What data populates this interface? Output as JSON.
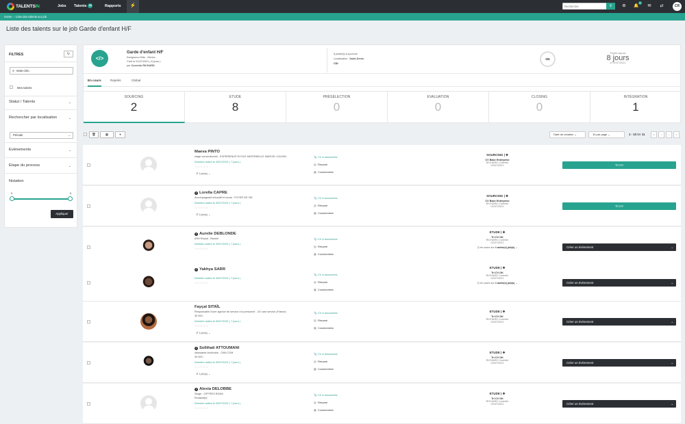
{
  "nav": {
    "logo_main": "TALENTS",
    "logo_accent": "IN",
    "items": [
      {
        "label": "Jobs",
        "badge": ""
      },
      {
        "label": "Talents",
        "badge": "99"
      },
      {
        "label": "Rapports",
        "badge": ""
      }
    ],
    "search_placeholder": "Recherche",
    "notifications_badge": "12",
    "user_initials": "CR"
  },
  "breadcrumb": [
    "Home",
    "Liste des talents sur job"
  ],
  "page_title": "Liste des talents sur le job Garde d'enfant H/F",
  "filters": {
    "title": "FILTRES",
    "keyword_placeholder": "Mots-clés :",
    "my_talents_label": "Mes talents",
    "sections": [
      "Statut / Talents",
      "Rechercher par localisation",
      "Evénements",
      "Etape du process",
      "Notation"
    ],
    "period_placeholder": "Période",
    "rating_min": "0",
    "rating_max": "5",
    "apply_label": "Appliquer"
  },
  "job": {
    "title": "Garde d'enfant H/F",
    "company": "Kangourou Kids - Nîmes -",
    "created": "Créé le 01/07/2021 ( 8 jours )",
    "by_prefix": "par",
    "by_name": "Corentin RICHARD",
    "positions_count": "1",
    "positions_label": "poste(s) à pourvoir",
    "location_label": "Localisation :",
    "location": "Saint-Denis",
    "contract": "CDI",
    "progress": "0/5",
    "published_label": "Publié depuis",
    "published_value": "8 jours",
    "published_date": "le 01/07/2021",
    "tabs": [
      "En cours",
      "Rejetés",
      "Global"
    ]
  },
  "stages": [
    {
      "name": "SOURCING",
      "count": "2"
    },
    {
      "name": "ETUDE",
      "count": "8"
    },
    {
      "name": "PRÉSÉLECTION",
      "count": "0"
    },
    {
      "name": "EVALUATION",
      "count": "0"
    },
    {
      "name": "CLOSING",
      "count": "0"
    },
    {
      "name": "INTÉGRATION",
      "count": "1"
    }
  ],
  "toolbar": {
    "sort": "Date de création",
    "per_page": "10 par page",
    "range": "1 - 10",
    "of": "De",
    "total": "11"
  },
  "rows": [
    {
      "name": "Maeva PINTO",
      "info": false,
      "desc1": "stage conventionnel - EXPERIENCE ECOLE MATERNELLE MARCEL CACHIN",
      "desc2": "",
      "last": "Dernière action le 02/07/2021 ( 7 jours )",
      "jobs": "1 job(s)",
      "cv": "CV & documents",
      "resume": "Résumé",
      "contact": "Coordonnées",
      "stage": "SOURCING",
      "step": "CV Base Enterprise",
      "by": "RICHARD Corentin",
      "date": "02/07/2021",
      "other": "",
      "btn": "Tri CV",
      "btn_type": "teal"
    },
    {
      "name": "Lorella CAPRE",
      "info": true,
      "desc1": "Accompagnant éducatif et social - FOYER DE VIE",
      "desc2": "",
      "last": "Dernière action le 02/07/2021 ( 7 jours )",
      "jobs": "1 job(s)",
      "cv": "CV & documents",
      "resume": "Résumé",
      "contact": "Coordonnées",
      "stage": "SOURCING",
      "step": "CV Base Enterprise",
      "by": "RICHARD Corentin",
      "date": "02/07/2021",
      "other": "",
      "btn": "Tri CV",
      "btn_type": "teal"
    },
    {
      "name": "Aurelie DEBLONDE",
      "info": true,
      "desc1": "ASH Ehpad - Bandol",
      "desc2": "",
      "last": "Dernière action le 02/07/2021 ( 7 jours )",
      "jobs": "",
      "cv": "CV & documents",
      "resume": "Résumé",
      "contact": "Coordonnées",
      "stage": "ETUDE",
      "step": "Tri CV OK",
      "by": "RICHARD Corentin",
      "date": "02/07/2021",
      "other": "1 autre(s) job(s)",
      "btn": "Créer un événement",
      "btn_type": "dark"
    },
    {
      "name": "Yakhya SARR",
      "info": true,
      "desc1": "",
      "desc2": "",
      "last": "Dernière action le 02/07/2021 ( 7 jours )",
      "jobs": "",
      "cv": "CV & documents",
      "resume": "Résumé",
      "contact": "Coordonnées",
      "stage": "ETUDE",
      "step": "Tri CV OK",
      "by": "RICHARD Corentin",
      "date": "02/07/2021",
      "other": "1 autre(s) job(s)",
      "btn": "Créer un événement",
      "btn_type": "dark"
    },
    {
      "name": "Fayçal SITAÏL",
      "info": false,
      "desc1": "Responsable d'une agence de service à la personne - O2 care service (France)",
      "desc2": "30 000 -",
      "last": "Dernière action le 02/07/2021 ( 7 jours )",
      "jobs": "1 job(s)",
      "cv": "CV & documents",
      "resume": "Résumé",
      "contact": "Coordonnées",
      "stage": "ETUDE",
      "step": "Tri CV OK",
      "by": "RICHARD Corentin",
      "date": "02/07/2021",
      "other": "",
      "btn": "Créer un événement",
      "btn_type": "dark"
    },
    {
      "name": "Sollihati ATTOUMANI",
      "info": true,
      "desc1": "Assistante Archiviste - CMA CGM",
      "desc2": "30 000 -",
      "last": "Dernière action le 02/07/2021 ( 7 jours )",
      "jobs": "1 job(s)",
      "cv": "CV & documents",
      "resume": "Résumé",
      "contact": "Coordonnées",
      "stage": "ETUDE",
      "step": "Tri CV OK",
      "by": "RICHARD Corentin",
      "date": "02/07/2021",
      "other": "",
      "btn": "Créer un événement",
      "btn_type": "dark"
    },
    {
      "name": "Alexia DELOBBE",
      "info": true,
      "desc1": "Stage - CIFFREO BONA",
      "desc2": "Etudiant(e)",
      "last": "Dernière action le 02/07/2021 ( 7 jours )",
      "jobs": "",
      "cv": "CV & documents",
      "resume": "Résumé",
      "contact": "Coordonnées",
      "stage": "ETUDE",
      "step": "Tri CV OK",
      "by": "RICHARD Corentin",
      "date": "02/07/2021",
      "other": "",
      "btn": "Créer un événement",
      "btn_type": "dark"
    }
  ],
  "labels": {
    "in_progress_prefix": "en cours sur"
  },
  "colors": {
    "accent": "#27a38f",
    "dark": "#2b2f33"
  }
}
